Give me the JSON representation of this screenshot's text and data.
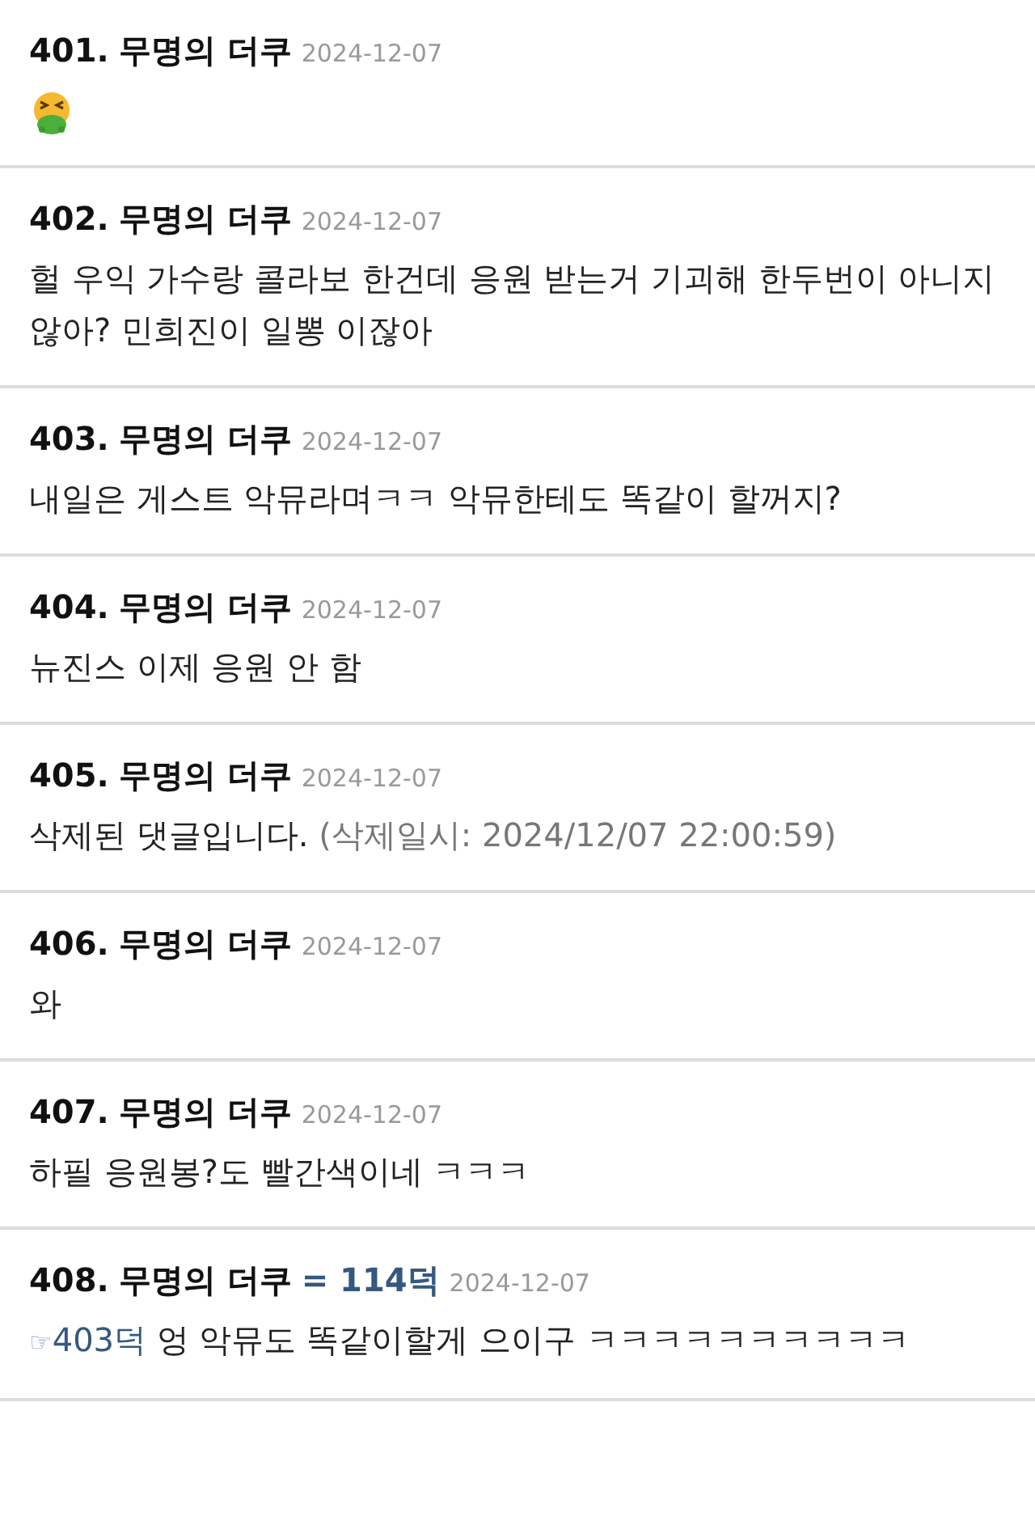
{
  "comments": [
    {
      "number": "401.",
      "author": "무명의 더쿠",
      "date": "2024-12-07",
      "kind": "emoji"
    },
    {
      "number": "402.",
      "author": "무명의 더쿠",
      "date": "2024-12-07",
      "kind": "text",
      "text": "헐 우익 가수랑 콜라보 한건데 응원 받는거 기괴해 한두번이 아니지 않아? 민희진이 일뽕 이잖아"
    },
    {
      "number": "403.",
      "author": "무명의 더쿠",
      "date": "2024-12-07",
      "kind": "text",
      "text": "내일은 게스트 악뮤라며ㅋㅋ 악뮤한테도 똑같이 할꺼지?"
    },
    {
      "number": "404.",
      "author": "무명의 더쿠",
      "date": "2024-12-07",
      "kind": "text",
      "text": "뉴진스 이제 응원 안 함"
    },
    {
      "number": "405.",
      "author": "무명의 더쿠",
      "date": "2024-12-07",
      "kind": "deleted",
      "text": "삭제된 댓글입니다.",
      "note": "(삭제일시: 2024/12/07 22:00:59)"
    },
    {
      "number": "406.",
      "author": "무명의 더쿠",
      "date": "2024-12-07",
      "kind": "text",
      "text": "와"
    },
    {
      "number": "407.",
      "author": "무명의 더쿠",
      "date": "2024-12-07",
      "kind": "text",
      "text": "하필 응원봉?도 빨간색이네 ㅋㅋㅋ"
    },
    {
      "number": "408.",
      "author": "무명의 더쿠",
      "same_as": "= 114덕",
      "date": "2024-12-07",
      "kind": "reply",
      "pointer": "☞",
      "ref": "403덕",
      "text": "엉 악뮤도 똑같이할게 으이구 ㅋㅋㅋㅋㅋㅋㅋㅋㅋㅋ"
    }
  ]
}
